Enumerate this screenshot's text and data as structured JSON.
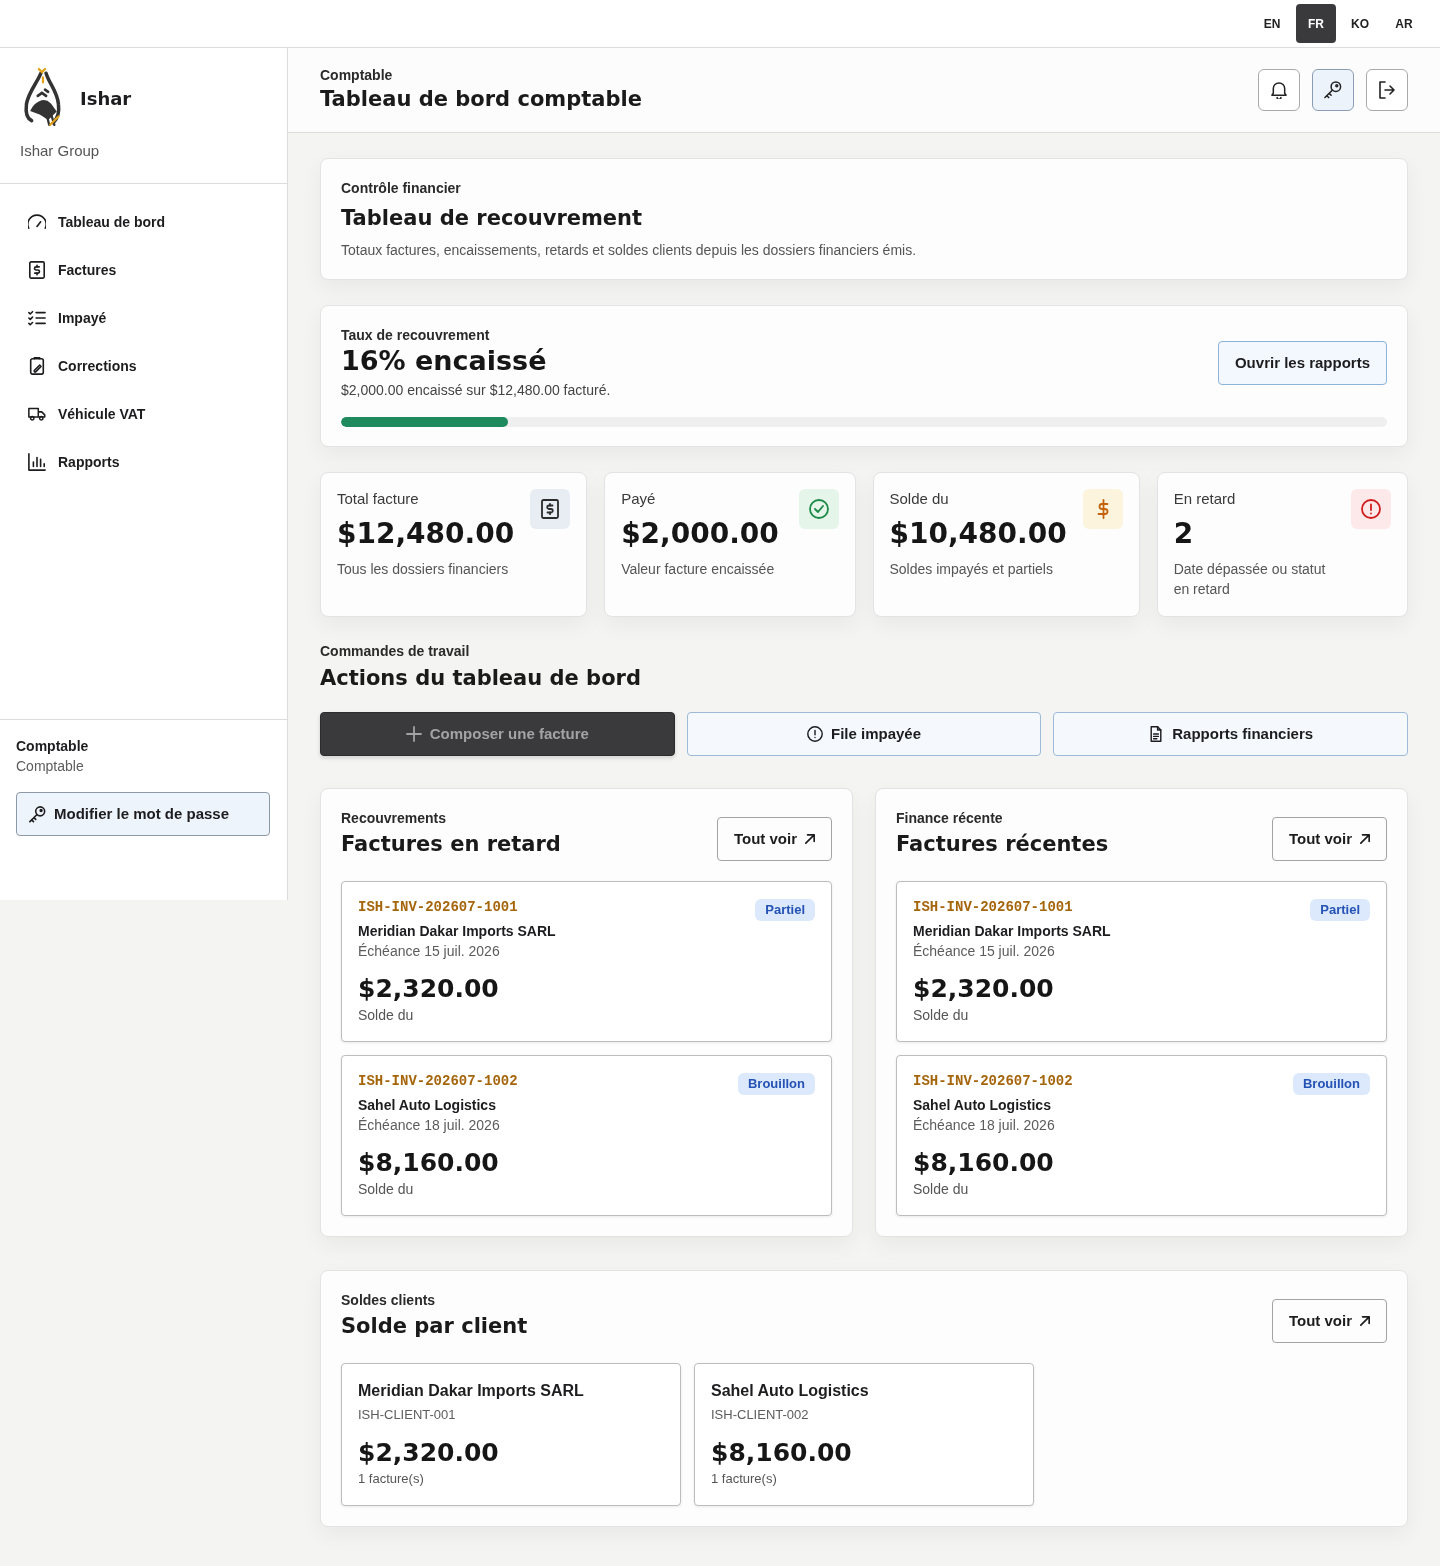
{
  "languages": [
    {
      "label": "EN",
      "selected": false
    },
    {
      "label": "FR",
      "selected": true
    },
    {
      "label": "KO",
      "selected": false
    },
    {
      "label": "AR",
      "selected": false
    }
  ],
  "sidebar": {
    "brand": {
      "name": "Ishar",
      "subtitle": "Ishar Group"
    },
    "items": [
      {
        "label": "Tableau de bord",
        "selected": false
      },
      {
        "label": "Factures",
        "selected": false
      },
      {
        "label": "Impayé",
        "selected": false
      },
      {
        "label": "Corrections",
        "selected": false
      },
      {
        "label": "Véhicule VAT",
        "selected": false
      },
      {
        "label": "Rapports",
        "selected": false
      }
    ],
    "user": {
      "name": "Comptable",
      "role": "Comptable"
    },
    "password_button": "Modifier le mot de passe"
  },
  "header": {
    "eyebrow": "Comptable",
    "title": "Tableau de bord comptable",
    "toolbar": [
      {
        "selected": false
      },
      {
        "selected": true
      },
      {
        "selected": false
      }
    ]
  },
  "overview": {
    "eyebrow": "Contrôle financier",
    "title": "Tableau de recouvrement",
    "description": "Totaux factures, encaissements, retards et soldes clients depuis les dossiers financiers émis."
  },
  "collection": {
    "eyebrow": "Taux de recouvrement",
    "headline": "16% encaissé",
    "summary": "$2,000.00 encaissé sur $12,480.00 facturé.",
    "level": 0.16,
    "button": "Ouvrir les rapports"
  },
  "stats": [
    {
      "kind": "invoice",
      "label": "Total facture",
      "value": "$12,480.00",
      "note": "Tous les dossiers financiers"
    },
    {
      "kind": "paid",
      "label": "Payé",
      "value": "$2,000.00",
      "note": "Valeur facture encaissée"
    },
    {
      "kind": "balance",
      "label": "Solde du",
      "value": "$10,480.00",
      "note": "Soldes impayés et partiels"
    },
    {
      "kind": "overdue",
      "label": "En retard",
      "value": "2",
      "note": "Date dépassée ou statut en retard"
    }
  ],
  "actions": {
    "eyebrow": "Commandes de travail",
    "title": "Actions du tableau de bord",
    "buttons": [
      {
        "kind": "dark",
        "label": "Composer une facture"
      },
      {
        "kind": "outline",
        "label": "File impayée"
      },
      {
        "kind": "outline",
        "label": "Rapports financiers"
      }
    ]
  },
  "panels": [
    {
      "eyebrow": "Recouvrements",
      "title": "Factures en retard",
      "link": "Tout voir",
      "invoices": [
        {
          "number": "ISH-INV-202607-1001",
          "status": "Partiel",
          "client": "Meridian Dakar Imports SARL",
          "due": "Échéance 15 juil. 2026",
          "amount": "$2,320.00",
          "amount_label": "Solde du"
        },
        {
          "number": "ISH-INV-202607-1002",
          "status": "Brouillon",
          "client": "Sahel Auto Logistics",
          "due": "Échéance 18 juil. 2026",
          "amount": "$8,160.00",
          "amount_label": "Solde du"
        }
      ]
    },
    {
      "eyebrow": "Finance récente",
      "title": "Factures récentes",
      "link": "Tout voir",
      "invoices": [
        {
          "number": "ISH-INV-202607-1001",
          "status": "Partiel",
          "client": "Meridian Dakar Imports SARL",
          "due": "Échéance 15 juil. 2026",
          "amount": "$2,320.00",
          "amount_label": "Solde du"
        },
        {
          "number": "ISH-INV-202607-1002",
          "status": "Brouillon",
          "client": "Sahel Auto Logistics",
          "due": "Échéance 18 juil. 2026",
          "amount": "$8,160.00",
          "amount_label": "Solde du"
        }
      ]
    }
  ],
  "clients": {
    "eyebrow": "Soldes clients",
    "title": "Solde par client",
    "link": "Tout voir",
    "items": [
      {
        "name": "Meridian Dakar Imports SARL",
        "code": "ISH-CLIENT-001",
        "amount": "$2,320.00",
        "count": "1 facture(s)"
      },
      {
        "name": "Sahel Auto Logistics",
        "code": "ISH-CLIENT-002",
        "amount": "$8,160.00",
        "count": "1 facture(s)"
      }
    ]
  }
}
